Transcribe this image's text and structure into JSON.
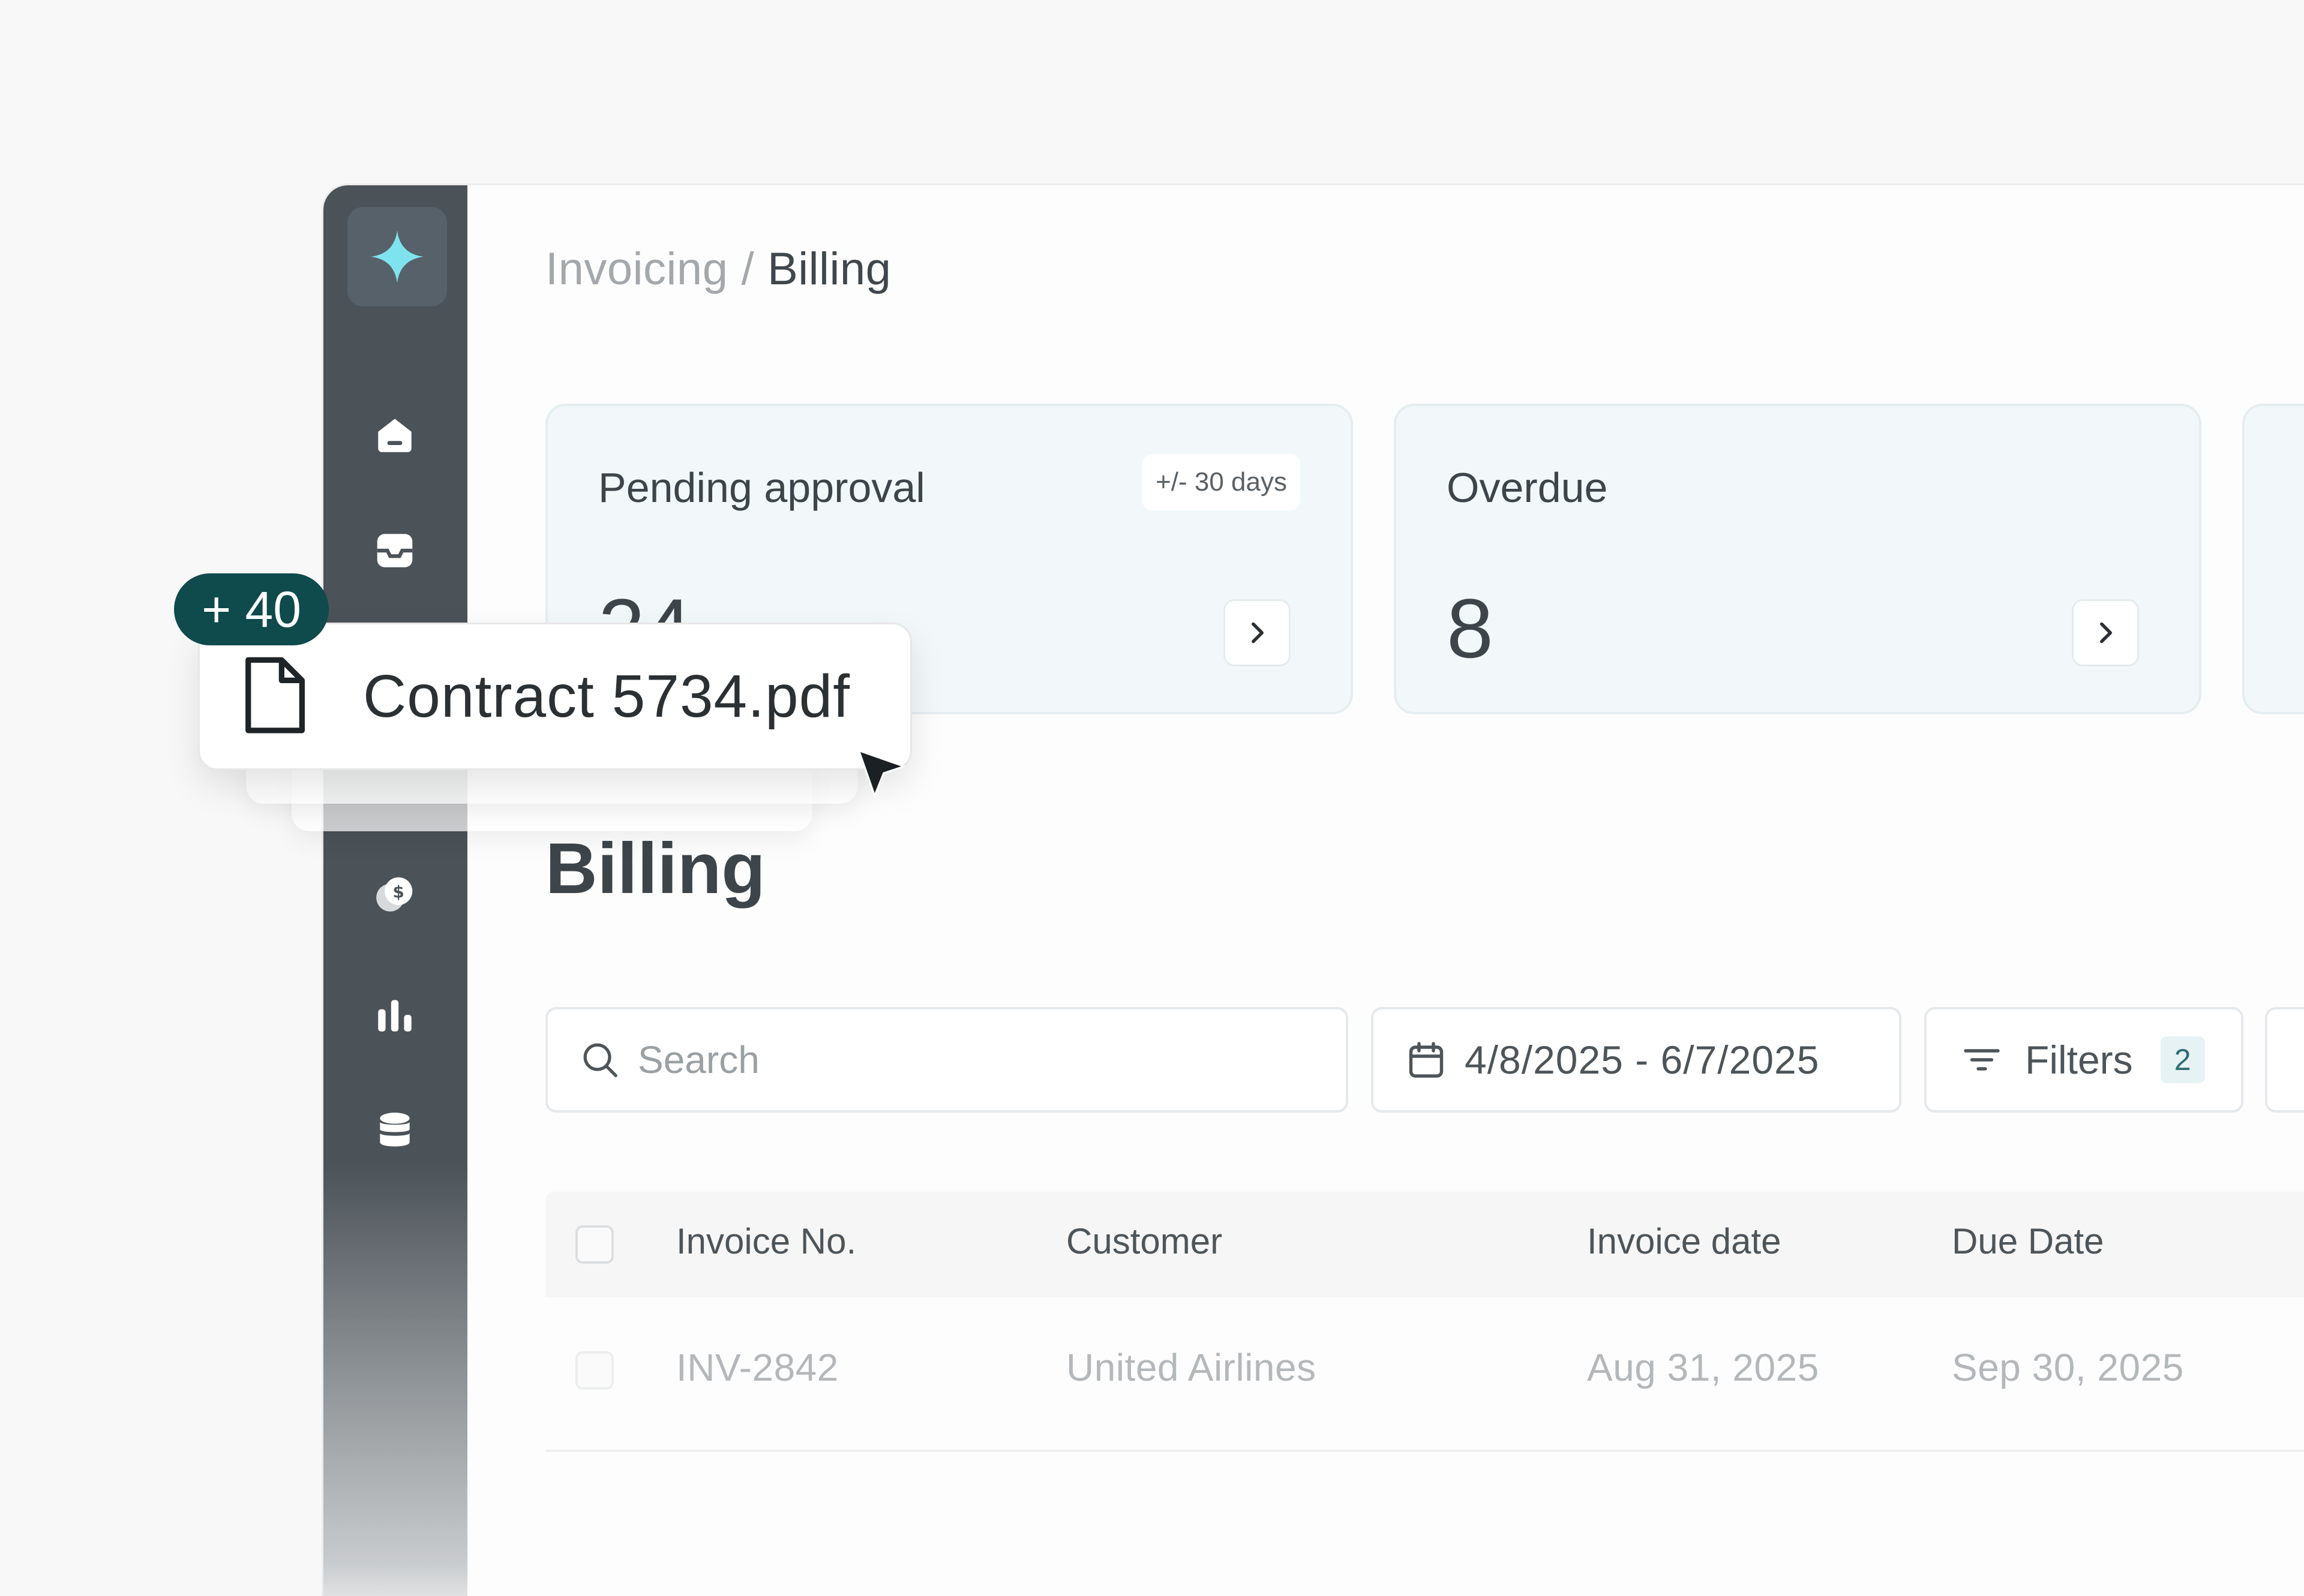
{
  "breadcrumb": {
    "parent": "Invoicing",
    "separator": "/",
    "current": "Billing"
  },
  "nav": {
    "logo_icon": "sparkle-icon",
    "icons": [
      "home-icon",
      "inbox-icon",
      "coins-icon",
      "bar-chart-icon",
      "database-icon"
    ]
  },
  "cards": [
    {
      "title": "Pending approval",
      "value": "24",
      "badge": "+/- 30 days"
    },
    {
      "title": "Overdue",
      "value": "8"
    }
  ],
  "section_title": "Billing",
  "search": {
    "placeholder": "Search"
  },
  "date_range": "4/8/2025 - 6/7/2025",
  "filters": {
    "label": "Filters",
    "count": "2"
  },
  "table": {
    "columns": [
      "Invoice No.",
      "Customer",
      "Invoice date",
      "Due Date"
    ],
    "rows": [
      {
        "invoice_no": "INV-2842",
        "customer": "United Airlines",
        "invoice_date": "Aug 31, 2025",
        "due_date": "Sep 30, 2025"
      }
    ]
  },
  "drag": {
    "file_name": "Contract 5734.pdf",
    "count": "+ 40"
  },
  "colors": {
    "accent": "#0f4a4d",
    "logo": "#7fe3ef",
    "sidebar": "#4b5258",
    "card_bg": "#f2f8fa"
  }
}
